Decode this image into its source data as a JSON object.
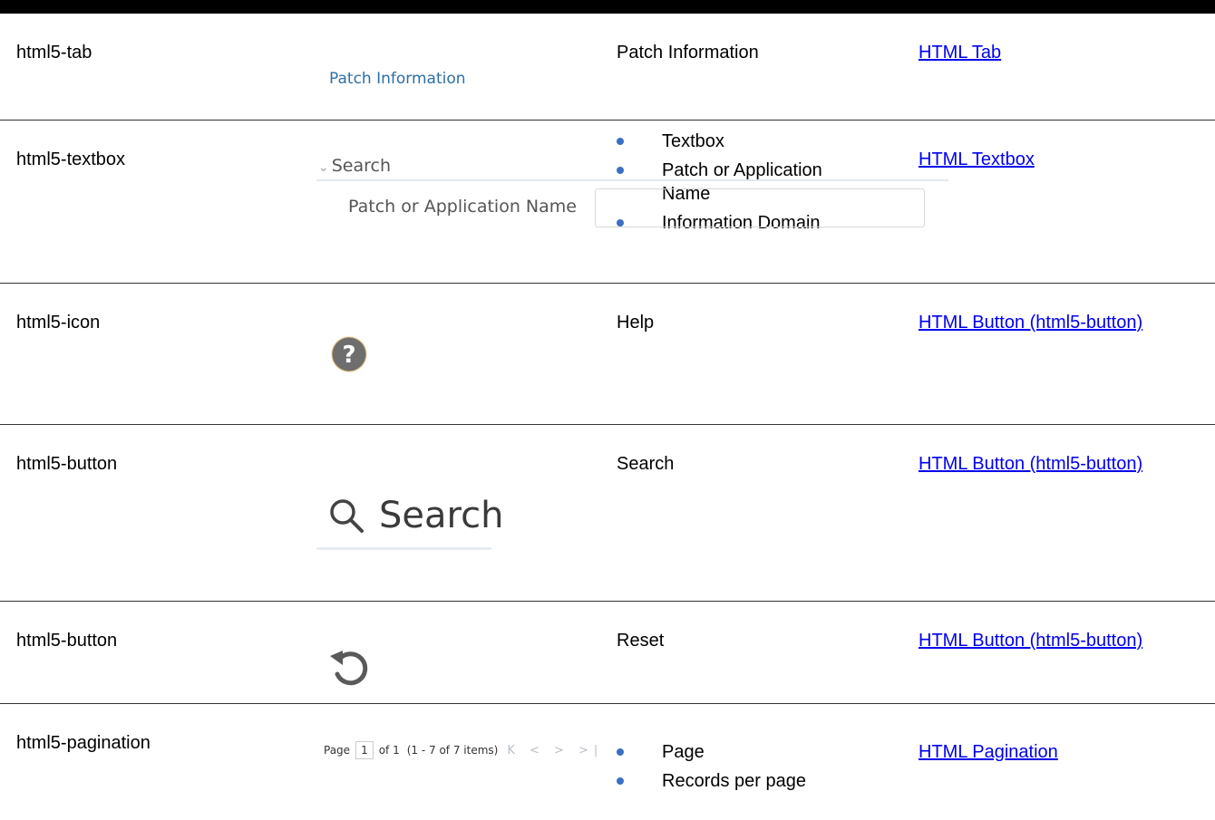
{
  "rows": [
    {
      "type": "html5-tab",
      "description": "Patch Information",
      "link": "HTML Tab",
      "ui": {
        "tab_label": "Patch Information"
      }
    },
    {
      "type": "html5-textbox",
      "bullets": [
        "Textbox",
        "Patch or Application Name",
        "Information Domain"
      ],
      "link": "HTML Textbox",
      "ui": {
        "section_label": "Search",
        "field_label": "Patch or Application Name"
      }
    },
    {
      "type": "html5-icon",
      "description": "Help",
      "link": "HTML Button (html5-button)",
      "ui": {
        "icon": "help-icon"
      }
    },
    {
      "type": "html5-button",
      "description": "Search",
      "link": "HTML Button (html5-button)",
      "ui": {
        "button_label": "Search",
        "icon": "search-icon"
      }
    },
    {
      "type": "html5-button",
      "description": "Reset",
      "link": "HTML Button (html5-button)",
      "ui": {
        "icon": "reset-icon"
      }
    },
    {
      "type": "html5-pagination",
      "bullets": [
        "Page",
        "Records per page"
      ],
      "link": "HTML Pagination",
      "ui": {
        "page_label": "Page",
        "page_value": "1",
        "of_label": "of 1",
        "range_label": "(1 - 7 of  7  items)",
        "nav_arrows": "K < > >|"
      }
    }
  ],
  "colors": {
    "link": "#0000ee",
    "bullet": "#3a6fc4",
    "tab_text": "#2e6fa6",
    "icon_gray": "#6b6b6b"
  }
}
